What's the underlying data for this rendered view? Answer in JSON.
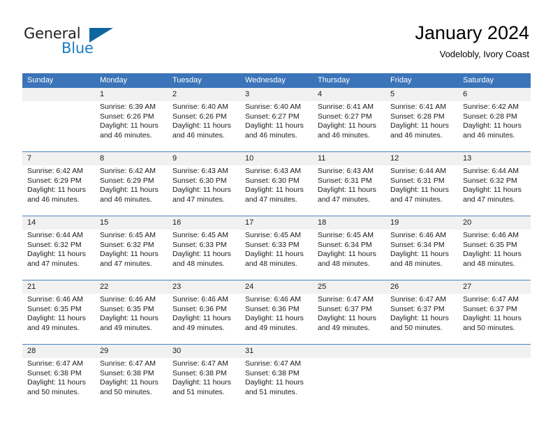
{
  "brand": {
    "name_part1": "General",
    "name_part2": "Blue",
    "accent_color": "#1a7cc2",
    "triangle_color": "#11659f"
  },
  "header": {
    "title": "January 2024",
    "subtitle": "Vodelobly, Ivory Coast",
    "header_bg_color": "#3b74b8",
    "separator_color": "#4a83c2",
    "daynum_bg_color": "#f1f1f1"
  },
  "weekday_headers": [
    "Sunday",
    "Monday",
    "Tuesday",
    "Wednesday",
    "Thursday",
    "Friday",
    "Saturday"
  ],
  "weeks": [
    {
      "days": [
        {
          "num": "",
          "detail": ""
        },
        {
          "num": "1",
          "detail": "Sunrise: 6:39 AM\nSunset: 6:26 PM\nDaylight: 11 hours\nand 46 minutes."
        },
        {
          "num": "2",
          "detail": "Sunrise: 6:40 AM\nSunset: 6:26 PM\nDaylight: 11 hours\nand 46 minutes."
        },
        {
          "num": "3",
          "detail": "Sunrise: 6:40 AM\nSunset: 6:27 PM\nDaylight: 11 hours\nand 46 minutes."
        },
        {
          "num": "4",
          "detail": "Sunrise: 6:41 AM\nSunset: 6:27 PM\nDaylight: 11 hours\nand 46 minutes."
        },
        {
          "num": "5",
          "detail": "Sunrise: 6:41 AM\nSunset: 6:28 PM\nDaylight: 11 hours\nand 46 minutes."
        },
        {
          "num": "6",
          "detail": "Sunrise: 6:42 AM\nSunset: 6:28 PM\nDaylight: 11 hours\nand 46 minutes."
        }
      ]
    },
    {
      "days": [
        {
          "num": "7",
          "detail": "Sunrise: 6:42 AM\nSunset: 6:29 PM\nDaylight: 11 hours\nand 46 minutes."
        },
        {
          "num": "8",
          "detail": "Sunrise: 6:42 AM\nSunset: 6:29 PM\nDaylight: 11 hours\nand 46 minutes."
        },
        {
          "num": "9",
          "detail": "Sunrise: 6:43 AM\nSunset: 6:30 PM\nDaylight: 11 hours\nand 47 minutes."
        },
        {
          "num": "10",
          "detail": "Sunrise: 6:43 AM\nSunset: 6:30 PM\nDaylight: 11 hours\nand 47 minutes."
        },
        {
          "num": "11",
          "detail": "Sunrise: 6:43 AM\nSunset: 6:31 PM\nDaylight: 11 hours\nand 47 minutes."
        },
        {
          "num": "12",
          "detail": "Sunrise: 6:44 AM\nSunset: 6:31 PM\nDaylight: 11 hours\nand 47 minutes."
        },
        {
          "num": "13",
          "detail": "Sunrise: 6:44 AM\nSunset: 6:32 PM\nDaylight: 11 hours\nand 47 minutes."
        }
      ]
    },
    {
      "days": [
        {
          "num": "14",
          "detail": "Sunrise: 6:44 AM\nSunset: 6:32 PM\nDaylight: 11 hours\nand 47 minutes."
        },
        {
          "num": "15",
          "detail": "Sunrise: 6:45 AM\nSunset: 6:32 PM\nDaylight: 11 hours\nand 47 minutes."
        },
        {
          "num": "16",
          "detail": "Sunrise: 6:45 AM\nSunset: 6:33 PM\nDaylight: 11 hours\nand 48 minutes."
        },
        {
          "num": "17",
          "detail": "Sunrise: 6:45 AM\nSunset: 6:33 PM\nDaylight: 11 hours\nand 48 minutes."
        },
        {
          "num": "18",
          "detail": "Sunrise: 6:45 AM\nSunset: 6:34 PM\nDaylight: 11 hours\nand 48 minutes."
        },
        {
          "num": "19",
          "detail": "Sunrise: 6:46 AM\nSunset: 6:34 PM\nDaylight: 11 hours\nand 48 minutes."
        },
        {
          "num": "20",
          "detail": "Sunrise: 6:46 AM\nSunset: 6:35 PM\nDaylight: 11 hours\nand 48 minutes."
        }
      ]
    },
    {
      "days": [
        {
          "num": "21",
          "detail": "Sunrise: 6:46 AM\nSunset: 6:35 PM\nDaylight: 11 hours\nand 49 minutes."
        },
        {
          "num": "22",
          "detail": "Sunrise: 6:46 AM\nSunset: 6:35 PM\nDaylight: 11 hours\nand 49 minutes."
        },
        {
          "num": "23",
          "detail": "Sunrise: 6:46 AM\nSunset: 6:36 PM\nDaylight: 11 hours\nand 49 minutes."
        },
        {
          "num": "24",
          "detail": "Sunrise: 6:46 AM\nSunset: 6:36 PM\nDaylight: 11 hours\nand 49 minutes."
        },
        {
          "num": "25",
          "detail": "Sunrise: 6:47 AM\nSunset: 6:37 PM\nDaylight: 11 hours\nand 49 minutes."
        },
        {
          "num": "26",
          "detail": "Sunrise: 6:47 AM\nSunset: 6:37 PM\nDaylight: 11 hours\nand 50 minutes."
        },
        {
          "num": "27",
          "detail": "Sunrise: 6:47 AM\nSunset: 6:37 PM\nDaylight: 11 hours\nand 50 minutes."
        }
      ]
    },
    {
      "days": [
        {
          "num": "28",
          "detail": "Sunrise: 6:47 AM\nSunset: 6:38 PM\nDaylight: 11 hours\nand 50 minutes."
        },
        {
          "num": "29",
          "detail": "Sunrise: 6:47 AM\nSunset: 6:38 PM\nDaylight: 11 hours\nand 50 minutes."
        },
        {
          "num": "30",
          "detail": "Sunrise: 6:47 AM\nSunset: 6:38 PM\nDaylight: 11 hours\nand 51 minutes."
        },
        {
          "num": "31",
          "detail": "Sunrise: 6:47 AM\nSunset: 6:38 PM\nDaylight: 11 hours\nand 51 minutes."
        },
        {
          "num": "",
          "detail": ""
        },
        {
          "num": "",
          "detail": ""
        },
        {
          "num": "",
          "detail": ""
        }
      ]
    }
  ]
}
